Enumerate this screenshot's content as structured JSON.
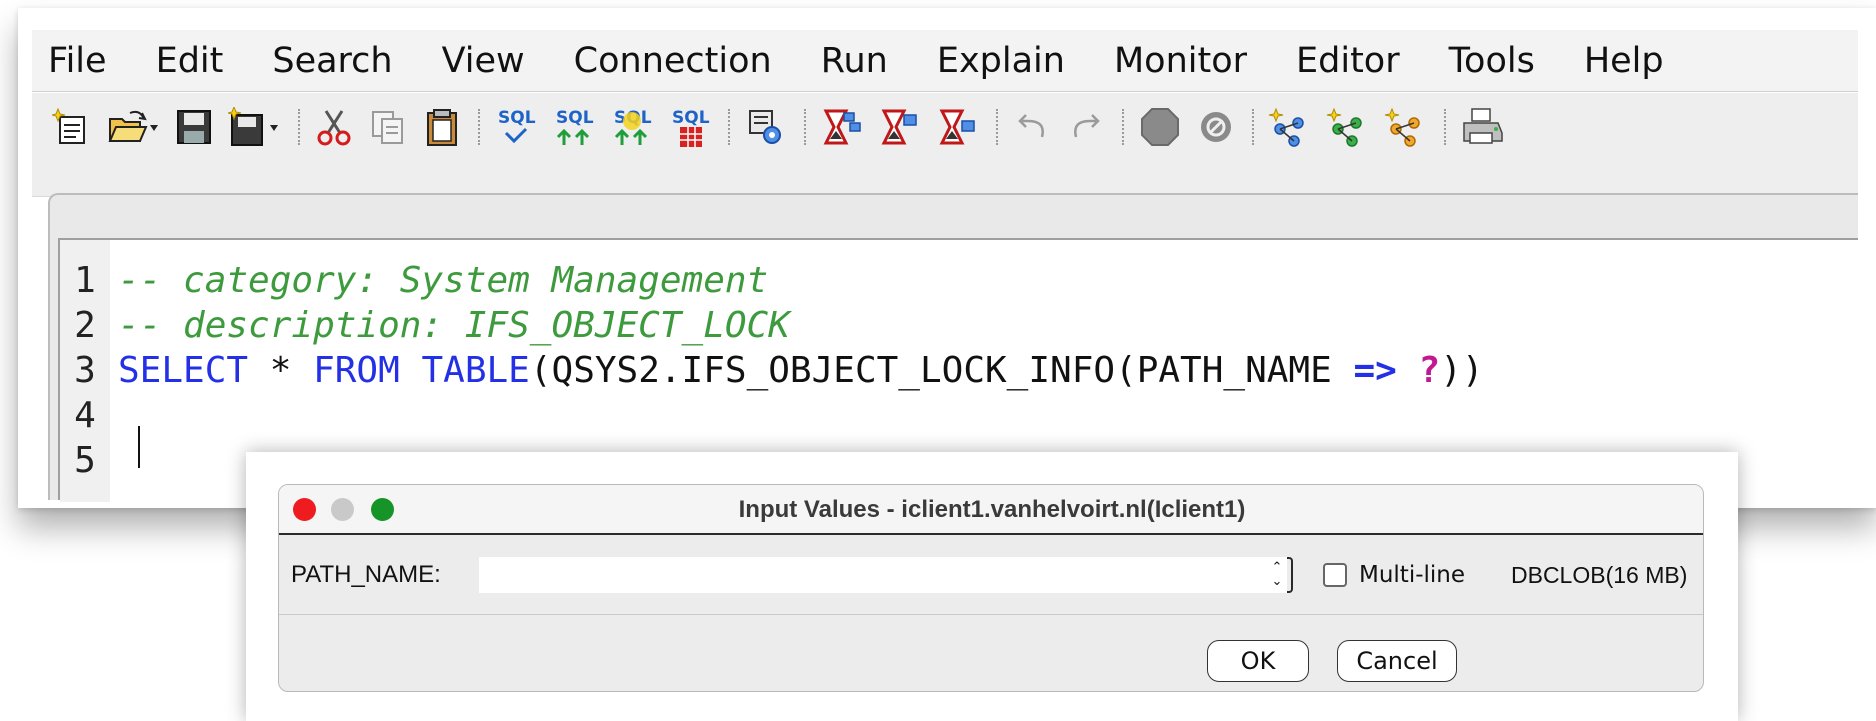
{
  "menubar": {
    "items": [
      "File",
      "Edit",
      "Search",
      "View",
      "Connection",
      "Run",
      "Explain",
      "Monitor",
      "Editor",
      "Tools",
      "Help"
    ]
  },
  "toolbar": {
    "sql_label": "SQL",
    "buttons": [
      "new-script",
      "open",
      "save",
      "save-as",
      "cut",
      "copy",
      "paste",
      "run-check-syntax",
      "run-from-selected",
      "run-all",
      "run-selected-to-table",
      "visual-explain",
      "explain-1",
      "explain-2",
      "explain-3",
      "undo",
      "redo",
      "stop",
      "cancel-request",
      "connect-1",
      "connect-2",
      "connect-3",
      "print"
    ]
  },
  "editor": {
    "lines": [
      {
        "number": "1",
        "text": "-- category: System Management"
      },
      {
        "number": "2",
        "text": "-- description: IFS_OBJECT_LOCK"
      },
      {
        "number": "3",
        "kw1": "SELECT",
        "t1": " * ",
        "kw2": "FROM",
        "t2": " ",
        "kw3": "TABLE",
        "t3": "(QSYS2.IFS_OBJECT_LOCK_INFO(PATH_NAME ",
        "op": "=>",
        "t4": " ",
        "qm": "?",
        "t5": "))"
      },
      {
        "number": "4",
        "text": ""
      },
      {
        "number": "5",
        "text": ""
      }
    ]
  },
  "dialog": {
    "title": "Input Values - iclient1.vanhelvoirt.nl(Iclient1)",
    "param_label": "PATH_NAME:",
    "param_value": "",
    "multiline_label": "Multi-line",
    "multiline_checked": false,
    "type_label": "DBCLOB(16 MB)",
    "ok_label": "OK",
    "cancel_label": "Cancel",
    "colors": {
      "close": "#ee1b1f",
      "minimize": "#c9c9c9",
      "zoom": "#179428"
    }
  }
}
